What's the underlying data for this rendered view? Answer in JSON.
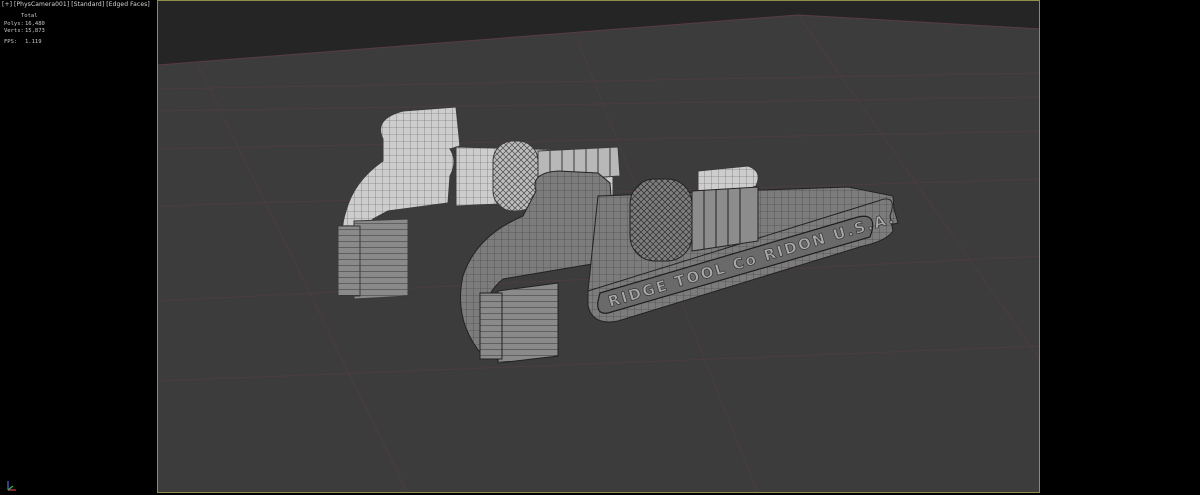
{
  "viewport": {
    "label": "[+] [PhysCamera001] [Standard] [Edged Faces]",
    "menus": [
      "+",
      "PhysCamera001",
      "Standard",
      "Edged Faces"
    ]
  },
  "stats": {
    "header": "Total",
    "polys_label": "Polys:",
    "polys_value": "16,480",
    "verts_label": "Verts:",
    "verts_value": "15,873",
    "fps_label": "FPS:",
    "fps_value": "1.119"
  },
  "model": {
    "engraving": "RIDGE TOOL Co RIDON U.S.A."
  },
  "colors": {
    "background": "#000000",
    "viewport_bg": "#363636",
    "floor": "#3c3c3c",
    "ceiling_band": "#252525",
    "grid_lines": "#5a3c42",
    "frame_border": "#8f8f46",
    "wrench_light": "#c9c9c9",
    "wrench_dark": "#7a7a7a"
  }
}
